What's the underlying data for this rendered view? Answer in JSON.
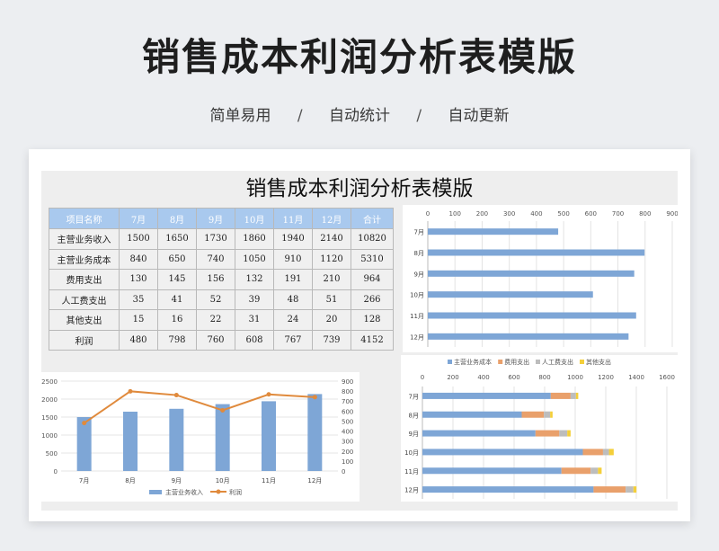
{
  "header": {
    "title": "销售成本利润分析表模版",
    "features": [
      "简单易用",
      "自动统计",
      "自动更新"
    ],
    "separator": "/"
  },
  "sheet": {
    "title": "销售成本利润分析表模版"
  },
  "table": {
    "headers": [
      "项目名称",
      "7月",
      "8月",
      "9月",
      "10月",
      "11月",
      "12月",
      "合计"
    ],
    "rows": [
      [
        "主营业务收入",
        "1500",
        "1650",
        "1730",
        "1860",
        "1940",
        "2140",
        "10820"
      ],
      [
        "主营业务成本",
        "840",
        "650",
        "740",
        "1050",
        "910",
        "1120",
        "5310"
      ],
      [
        "费用支出",
        "130",
        "145",
        "156",
        "132",
        "191",
        "210",
        "964"
      ],
      [
        "人工费支出",
        "35",
        "41",
        "52",
        "39",
        "48",
        "51",
        "266"
      ],
      [
        "其他支出",
        "15",
        "16",
        "22",
        "31",
        "24",
        "20",
        "128"
      ],
      [
        "利润",
        "480",
        "798",
        "760",
        "608",
        "767",
        "739",
        "4152"
      ]
    ],
    "colors": {
      "header_bg": "#a9c9ee"
    }
  },
  "chart_data": [
    {
      "type": "bar",
      "orientation": "horizontal",
      "categories": [
        "7月",
        "8月",
        "9月",
        "10月",
        "11月",
        "12月"
      ],
      "series": [
        {
          "values": [
            480,
            798,
            760,
            608,
            767,
            739
          ],
          "color": "#7ea6d6"
        }
      ],
      "xlim": [
        0,
        900
      ],
      "xticks": [
        "0",
        "100",
        "200",
        "300",
        "400",
        "500",
        "600",
        "700",
        "800",
        "900"
      ],
      "axis_position": "top",
      "grid": true
    },
    {
      "type": "bar",
      "orientation": "horizontal",
      "stacked": true,
      "categories": [
        "7月",
        "8月",
        "9月",
        "10月",
        "11月",
        "12月"
      ],
      "series": [
        {
          "name": "主营业务成本",
          "values": [
            840,
            650,
            740,
            1050,
            910,
            1120
          ],
          "color": "#7ea6d6"
        },
        {
          "name": "费用支出",
          "values": [
            130,
            145,
            156,
            132,
            191,
            210
          ],
          "color": "#e9a06b"
        },
        {
          "name": "人工费支出",
          "values": [
            35,
            41,
            52,
            39,
            48,
            51
          ],
          "color": "#bdbdbd"
        },
        {
          "name": "其他支出",
          "values": [
            15,
            16,
            22,
            31,
            24,
            20
          ],
          "color": "#f4cf3a"
        }
      ],
      "xlim": [
        0,
        1600
      ],
      "xticks": [
        "0",
        "200",
        "400",
        "600",
        "800",
        "1000",
        "1200",
        "1400",
        "1600"
      ],
      "legend": "top",
      "grid": true
    },
    {
      "type": "bar+line",
      "categories": [
        "7月",
        "8月",
        "9月",
        "10月",
        "11月",
        "12月"
      ],
      "series": [
        {
          "name": "主营业务收入",
          "type": "bar",
          "axis": "left",
          "values": [
            1500,
            1650,
            1730,
            1860,
            1940,
            2140
          ],
          "color": "#7ea6d6"
        },
        {
          "name": "利润",
          "type": "line",
          "axis": "right",
          "values": [
            480,
            798,
            760,
            608,
            767,
            739
          ],
          "color": "#e08a3c"
        }
      ],
      "ylim_left": [
        0,
        2500
      ],
      "yticks_left": [
        "0",
        "500",
        "1000",
        "1500",
        "2000",
        "2500"
      ],
      "ylim_right": [
        0,
        900
      ],
      "yticks_right": [
        "0",
        "100",
        "200",
        "300",
        "400",
        "500",
        "600",
        "700",
        "800",
        "900"
      ],
      "legend": "bottom",
      "grid": true
    }
  ]
}
